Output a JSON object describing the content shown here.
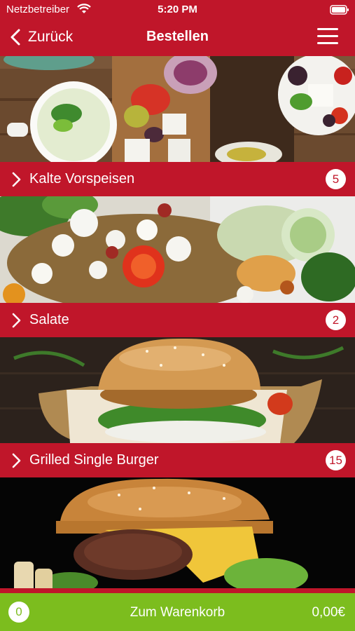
{
  "status_bar": {
    "carrier": "Netzbetreiber",
    "time": "5:20 PM"
  },
  "nav": {
    "back_label": "Zurück",
    "title": "Bestellen"
  },
  "categories": [
    {
      "label": "Kalte Vorspeisen",
      "count": "5"
    },
    {
      "label": "Salate",
      "count": "2"
    },
    {
      "label": "Grilled Single Burger",
      "count": "15"
    }
  ],
  "cart": {
    "count": "0",
    "label": "Zum Warenkorb",
    "total": "0,00€"
  },
  "colors": {
    "brand_red": "#c0162a",
    "cart_green": "#7cbd1e"
  }
}
